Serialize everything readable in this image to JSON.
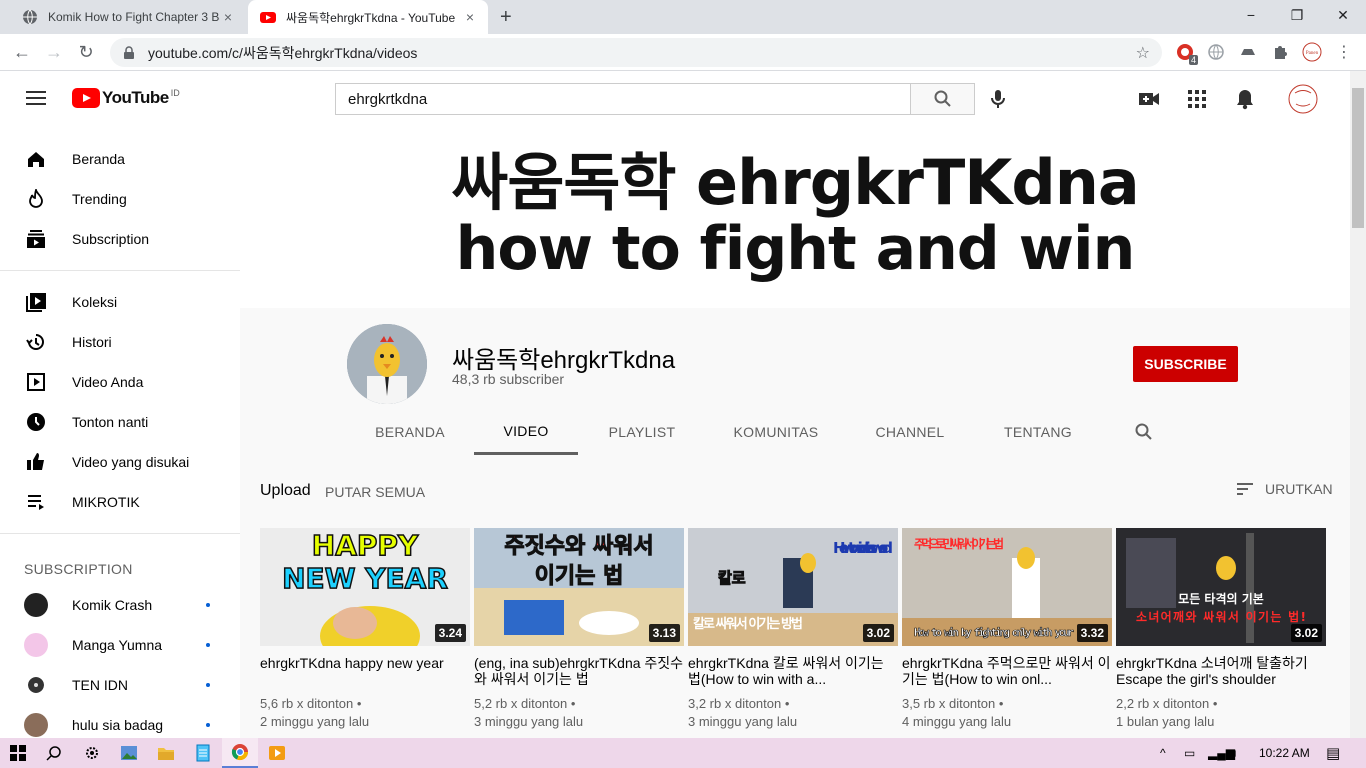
{
  "browser": {
    "tabs": [
      {
        "title": "Komik How to Fight Chapter 3 Ba",
        "close": "×"
      },
      {
        "title": "싸움독학ehrgkrTkdna - YouTube",
        "close": "×"
      }
    ],
    "new_tab": "+",
    "window_controls": {
      "minimize": "−",
      "maximize": "❐",
      "close": "✕"
    },
    "url": "youtube.com/c/싸움독학ehrgkrTkdna/videos",
    "extension_badge": "4"
  },
  "youtube": {
    "logo_text": "YouTube",
    "country_code": "ID",
    "search_value": "ehrgkrtkdna"
  },
  "sidebar": {
    "main": [
      {
        "label": "Beranda",
        "icon": "home-icon"
      },
      {
        "label": "Trending",
        "icon": "fire-icon"
      },
      {
        "label": "Subscription",
        "icon": "subscriptions-icon"
      }
    ],
    "library": [
      {
        "label": "Koleksi",
        "icon": "library-icon"
      },
      {
        "label": "Histori",
        "icon": "history-icon"
      },
      {
        "label": "Video Anda",
        "icon": "play-square-icon"
      },
      {
        "label": "Tonton nanti",
        "icon": "clock-icon"
      },
      {
        "label": "Video yang disukai",
        "icon": "thumbs-up-icon"
      },
      {
        "label": "MIKROTIK",
        "icon": "playlist-icon"
      }
    ],
    "subscription_header": "SUBSCRIPTION",
    "subscriptions": [
      {
        "label": "Komik Crash"
      },
      {
        "label": "Manga Yumna"
      },
      {
        "label": "TEN IDN"
      },
      {
        "label": "hulu sia badag"
      }
    ]
  },
  "channel": {
    "banner_line1": "싸움독학 ehrgkrTKdna",
    "banner_line2": "how to fight and win",
    "name": "싸움독학ehrgkrTkdna",
    "subscribers": "48,3 rb subscriber",
    "subscribe_label": "SUBSCRIBE",
    "tabs": [
      "BERANDA",
      "VIDEO",
      "PLAYLIST",
      "KOMUNITAS",
      "CHANNEL",
      "TENTANG"
    ],
    "active_tab": "VIDEO"
  },
  "uploads": {
    "title": "Upload",
    "play_all": "PUTAR SEMUA",
    "sort": "URUTKAN",
    "videos": [
      {
        "title": "ehrgkrTKdna happy new year",
        "duration": "3.24",
        "views": "5,6 rb x ditonton •",
        "age": "2 minggu yang lalu",
        "thumb_text1": "HAPPY",
        "thumb_text2": "NEW YEAR"
      },
      {
        "title": "(eng, ina sub)ehrgkrTKdna 주짓수와 싸워서 이기는 법",
        "duration": "3.13",
        "views": "5,2 rb x ditonton •",
        "age": "3 minggu yang lalu",
        "thumb_text1": "주짓수와 싸워서",
        "thumb_text2": "이기는 법"
      },
      {
        "title": "ehrgkrTKdna 칼로 싸워서 이기는 법(How to win with a...",
        "duration": "3.02",
        "views": "3,2 rb x ditonton •",
        "age": "3 minggu yang lalu",
        "thumb_text1": "How to win with a sword",
        "thumb_text2": "칼로 싸워서 이기는 방법"
      },
      {
        "title": "ehrgkrTKdna 주먹으로만 싸워서 이기는 법(How to win onl...",
        "duration": "3.32",
        "views": "3,5 rb x ditonton •",
        "age": "4 minggu yang lalu",
        "thumb_text1": "주먹으로만 싸워서 이기는 법",
        "thumb_text2": "How to win by fighting only with your"
      },
      {
        "title": "ehrgkrTKdna 소녀어깨 탈출하기 Escape the girl's shoulder",
        "duration": "3.02",
        "views": "2,2 rb x ditonton •",
        "age": "1 bulan yang lalu",
        "thumb_text1": "모든 타격의 기본",
        "thumb_text2": "소녀어깨와 싸워서 이기는 법!"
      }
    ]
  },
  "taskbar": {
    "time": "10:22 AM"
  },
  "colors": {
    "youtube_red": "#ff0000",
    "subscribe_red": "#cc0000",
    "taskbar": "#eed7ea"
  }
}
